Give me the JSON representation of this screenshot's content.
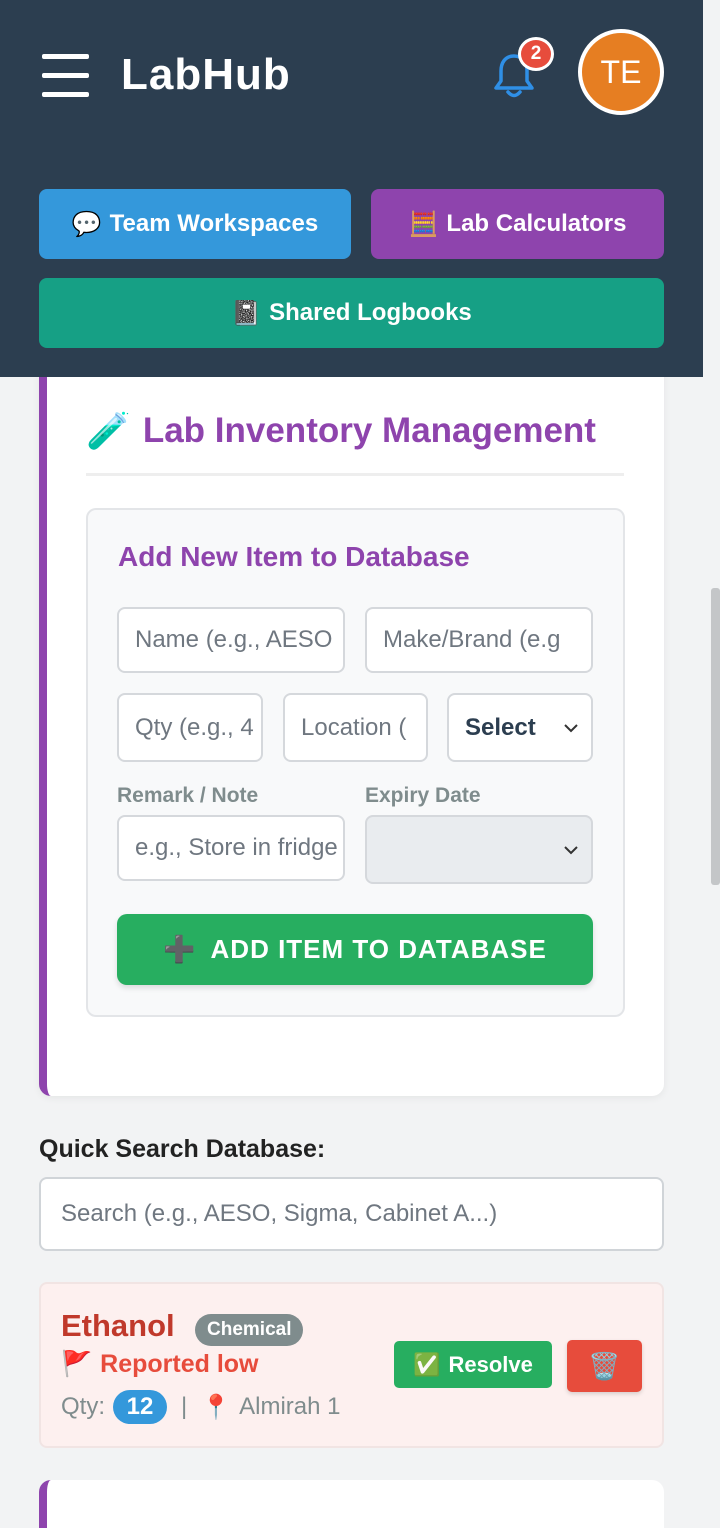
{
  "header": {
    "app_title": "LabHub",
    "notification_count": "2",
    "avatar_initials": "TE",
    "buttons": [
      {
        "icon": "💬",
        "label": "Team Workspaces"
      },
      {
        "icon": "🧮",
        "label": "Lab Calculators"
      },
      {
        "icon": "📓",
        "label": "Shared Logbooks"
      }
    ]
  },
  "inventory": {
    "icon": "🧪",
    "title": "Lab Inventory Management",
    "form": {
      "title": "Add New Item to Database",
      "name_placeholder": "Name (e.g., AESO",
      "make_placeholder": "Make/Brand (e.g",
      "qty_placeholder": "Qty (e.g., 4",
      "location_placeholder": "Location (",
      "select_value": "Select",
      "remark_label": "Remark / Note",
      "remark_placeholder": "e.g., Store in fridge",
      "expiry_label": "Expiry Date",
      "add_button_icon": "➕",
      "add_button_label": "ADD ITEM TO DATABASE"
    }
  },
  "search": {
    "label": "Quick Search Database:",
    "placeholder": "Search (e.g., AESO, Sigma, Cabinet A...)"
  },
  "items": [
    {
      "name": "Ethanol",
      "category": "Chemical",
      "status_icon": "🚩",
      "status": "Reported low",
      "qty_label": "Qty:",
      "qty": "12",
      "separator": "|",
      "location_icon": "📍",
      "location": "Almirah 1",
      "resolve_icon": "✅",
      "resolve_label": "Resolve",
      "delete_icon": "🗑️"
    }
  ],
  "colors": {
    "header_bg": "#2c3e50",
    "accent_purple": "#8e44ad",
    "blue": "#3498db",
    "teal": "#16a085",
    "green": "#27ae60",
    "red": "#e74c3c",
    "orange": "#e67e22"
  }
}
